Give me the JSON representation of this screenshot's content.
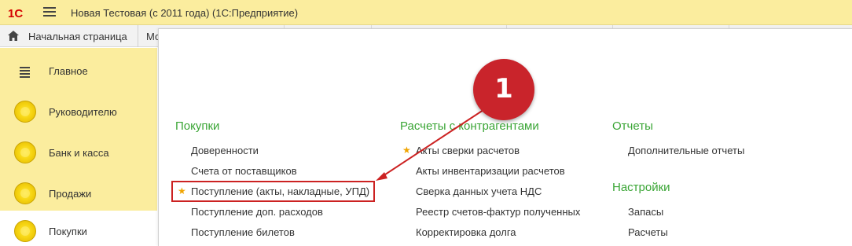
{
  "app": {
    "logo_text": "1С",
    "title": "Новая Тестовая (с 2011 года)  (1С:Предприятие)"
  },
  "tabs": {
    "home_label": "Начальная страница",
    "partial_label": "Мо"
  },
  "sidebar": {
    "items": [
      {
        "label": "Главное",
        "icon": "list-icon"
      },
      {
        "label": "Руководителю",
        "icon": "coin-icon"
      },
      {
        "label": "Банк и касса",
        "icon": "coin-icon"
      },
      {
        "label": "Продажи",
        "icon": "coin-icon"
      },
      {
        "label": "Покупки",
        "icon": "coin-icon",
        "active": true
      }
    ]
  },
  "menu": {
    "col1": {
      "header": "Покупки",
      "items": [
        "Доверенности",
        "Счета от поставщиков",
        "Поступление (акты, накладные, УПД)",
        "Поступление доп. расходов",
        "Поступление билетов"
      ]
    },
    "col2": {
      "header": "Расчеты с контрагентами",
      "items": [
        "Акты сверки расчетов",
        "Акты инвентаризации расчетов",
        "Сверка данных учета НДС",
        "Реестр счетов-фактур полученных",
        "Корректировка долга"
      ]
    },
    "col3": {
      "header1": "Отчеты",
      "items1": [
        "Дополнительные отчеты"
      ],
      "header2": "Настройки",
      "items2": [
        "Запасы",
        "Расчеты"
      ]
    }
  },
  "annotation": {
    "badge_number": "1",
    "color": "#c9242b"
  },
  "colors": {
    "brand_yellow": "#fbed9e",
    "section_green": "#3aa535",
    "star_orange": "#f0a400",
    "highlight_red": "#cc2222"
  }
}
